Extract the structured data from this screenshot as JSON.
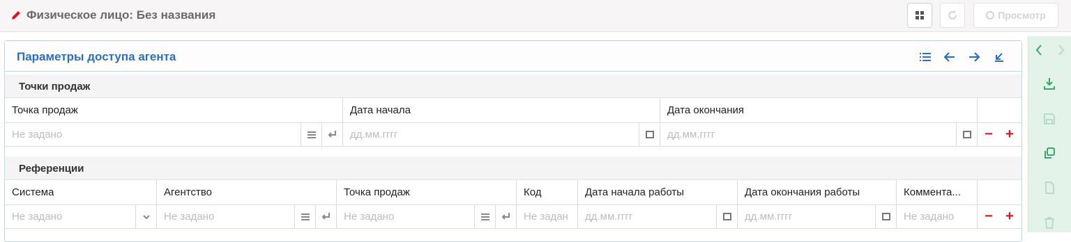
{
  "header": {
    "title": "Физическое лицо: Без названия",
    "view_label": "Просмотр"
  },
  "panel": {
    "title": "Параметры доступа агента"
  },
  "points": {
    "section_title": "Точки продаж",
    "columns": [
      "Точка продаж",
      "Дата начала",
      "Дата окончания"
    ],
    "row": {
      "point": "Не задано",
      "start": "дд.мм.гггг",
      "end": "дд.мм.гггг"
    }
  },
  "refs": {
    "section_title": "Референции",
    "columns": [
      "Система",
      "Агентство",
      "Точка продаж",
      "Код",
      "Дата начала работы",
      "Дата окончания работы",
      "Коммента..."
    ],
    "row": {
      "system": "Не задано",
      "agency": "Не задано",
      "point": "Не задано",
      "code": "Не задан",
      "start": "дд.мм.гггг",
      "end": "дд.мм.гггг",
      "comment": "Не задано"
    }
  },
  "colors": {
    "accent_blue": "#2b6fc2",
    "delete_red": "#e0141e",
    "rail_green": "#3aa76d"
  }
}
